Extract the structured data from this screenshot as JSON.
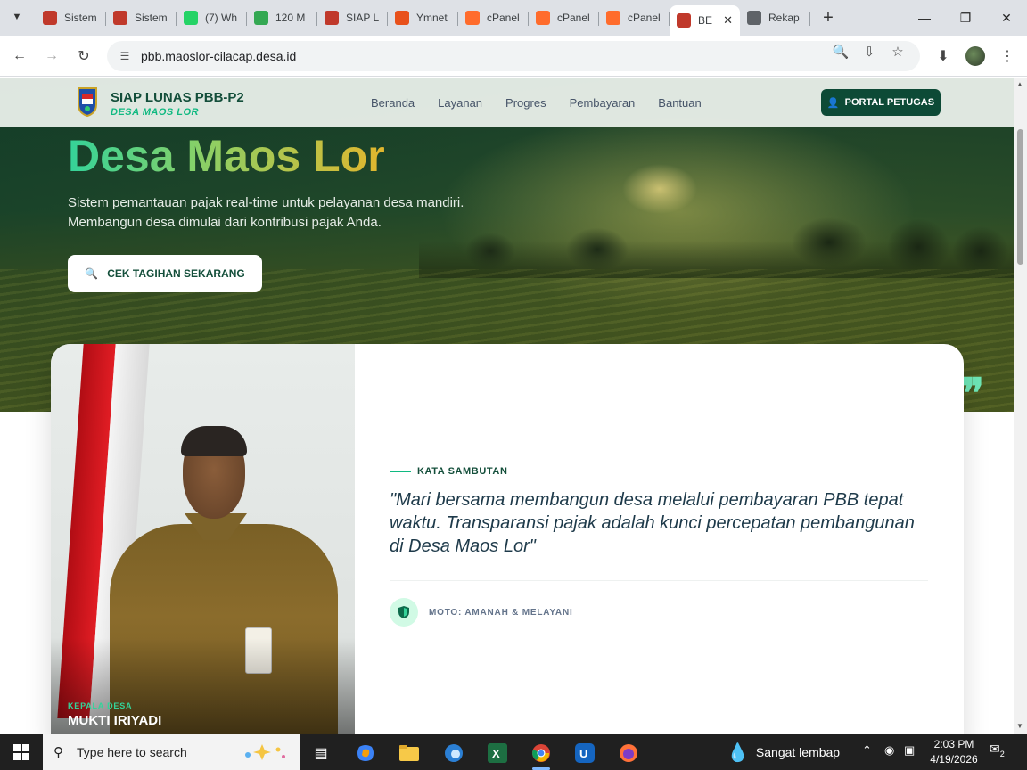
{
  "browser": {
    "tabs": [
      {
        "title": "Sistem",
        "favicon_color": "#c0392b"
      },
      {
        "title": "Sistem",
        "favicon_color": "#c0392b"
      },
      {
        "title": "(7) Wh",
        "favicon_color": "#25d366"
      },
      {
        "title": "120 M",
        "favicon_color": "#34a853"
      },
      {
        "title": "SIAP L",
        "favicon_color": "#c0392b"
      },
      {
        "title": "Ymnet",
        "favicon_color": "#e8511b"
      },
      {
        "title": "cPanel",
        "favicon_color": "#ff6c2c"
      },
      {
        "title": "cPanel",
        "favicon_color": "#ff6c2c"
      },
      {
        "title": "cPanel",
        "favicon_color": "#ff6c2c"
      },
      {
        "title": "BE",
        "favicon_color": "#c0392b",
        "active": true
      },
      {
        "title": "Rekap",
        "favicon_color": "#5f6368"
      }
    ],
    "url": "pbb.maoslor-cilacap.desa.id"
  },
  "site": {
    "brand_title": "SIAP LUNAS PBB-P2",
    "brand_subtitle": "DESA MAOS LOR",
    "nav": [
      "Beranda",
      "Layanan",
      "Progres",
      "Pembayaran",
      "Bantuan"
    ],
    "portal_button": "PORTAL PETUGAS",
    "hero_title": "Desa Maos Lor",
    "hero_line1": "Sistem pemantauan pajak real-time untuk pelayanan desa mandiri.",
    "hero_line2": "Membangun desa dimulai dari kontribusi pajak Anda.",
    "cta_button": "CEK TAGIHAN SEKARANG",
    "leader_role": "KEPALA DESA",
    "leader_name": "MUKTI IRIYADI",
    "kata_label": "KATA SAMBUTAN",
    "quote": "\"Mari bersama membangun desa melalui pembayaran PBB tepat waktu. Transparansi pajak adalah kunci percepatan pembangunan di Desa Maos Lor\"",
    "moto": "MOTO: AMANAH & MELAYANI",
    "accent_color": "#10b981",
    "primary_color": "#0d4a36"
  },
  "taskbar": {
    "search_placeholder": "Type here to search",
    "weather": "Sangat lembap",
    "time": "2:03 PM",
    "date": "4/19/2026",
    "notification_count": "2"
  }
}
